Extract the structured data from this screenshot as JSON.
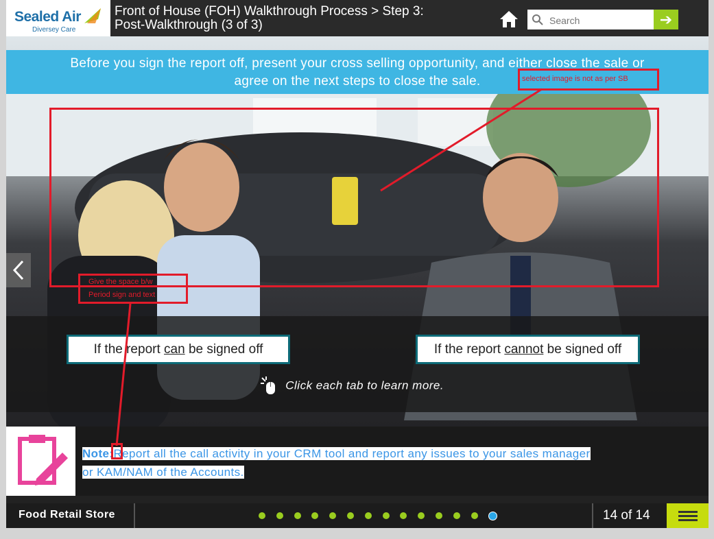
{
  "header": {
    "brand": "Sealed Air",
    "brand_sub": "Diversey Care",
    "title_line1": "Front of House (FOH) Walkthrough Process > Step 3:",
    "title_line2": "Post-Walkthrough (3 of 3)",
    "search_placeholder": "Search",
    "home_icon": "home-icon",
    "go_icon": "arrow-right-icon"
  },
  "banner": {
    "line1": "Before you sign the report off, present your cross selling opportunity, and either close the sale or",
    "line2": "agree on the next steps to close the sale."
  },
  "tabs": {
    "tab1_pre": "If the report ",
    "tab1_em": "can",
    "tab1_post": " be signed off",
    "tab2_pre": "If the report ",
    "tab2_em": "cannot",
    "tab2_post": " be signed off"
  },
  "hint": "Click each tab to learn more.",
  "note": {
    "label": "Note:",
    "text_line1": "Report all the call activity in your CRM tool and report any issues to your sales manager",
    "text_line2": "or KAM/NAM of the Accounts."
  },
  "footer": {
    "course": "Food Retail Store",
    "page": "14 of 14",
    "total_dots": 14,
    "current_dot": 14
  },
  "review_comments": {
    "image_comment": "selected image is not as per SB",
    "spacing_comment_line1": "Give the space b/w",
    "spacing_comment_line2": "Period sign and text"
  },
  "colors": {
    "banner": "#3fb6e3",
    "accent_green": "#9acd1f",
    "menu_yellow": "#c6dc0e",
    "tab_border": "#0d6b78",
    "note_pink": "#e8439b",
    "review_red": "#e21b2a"
  }
}
